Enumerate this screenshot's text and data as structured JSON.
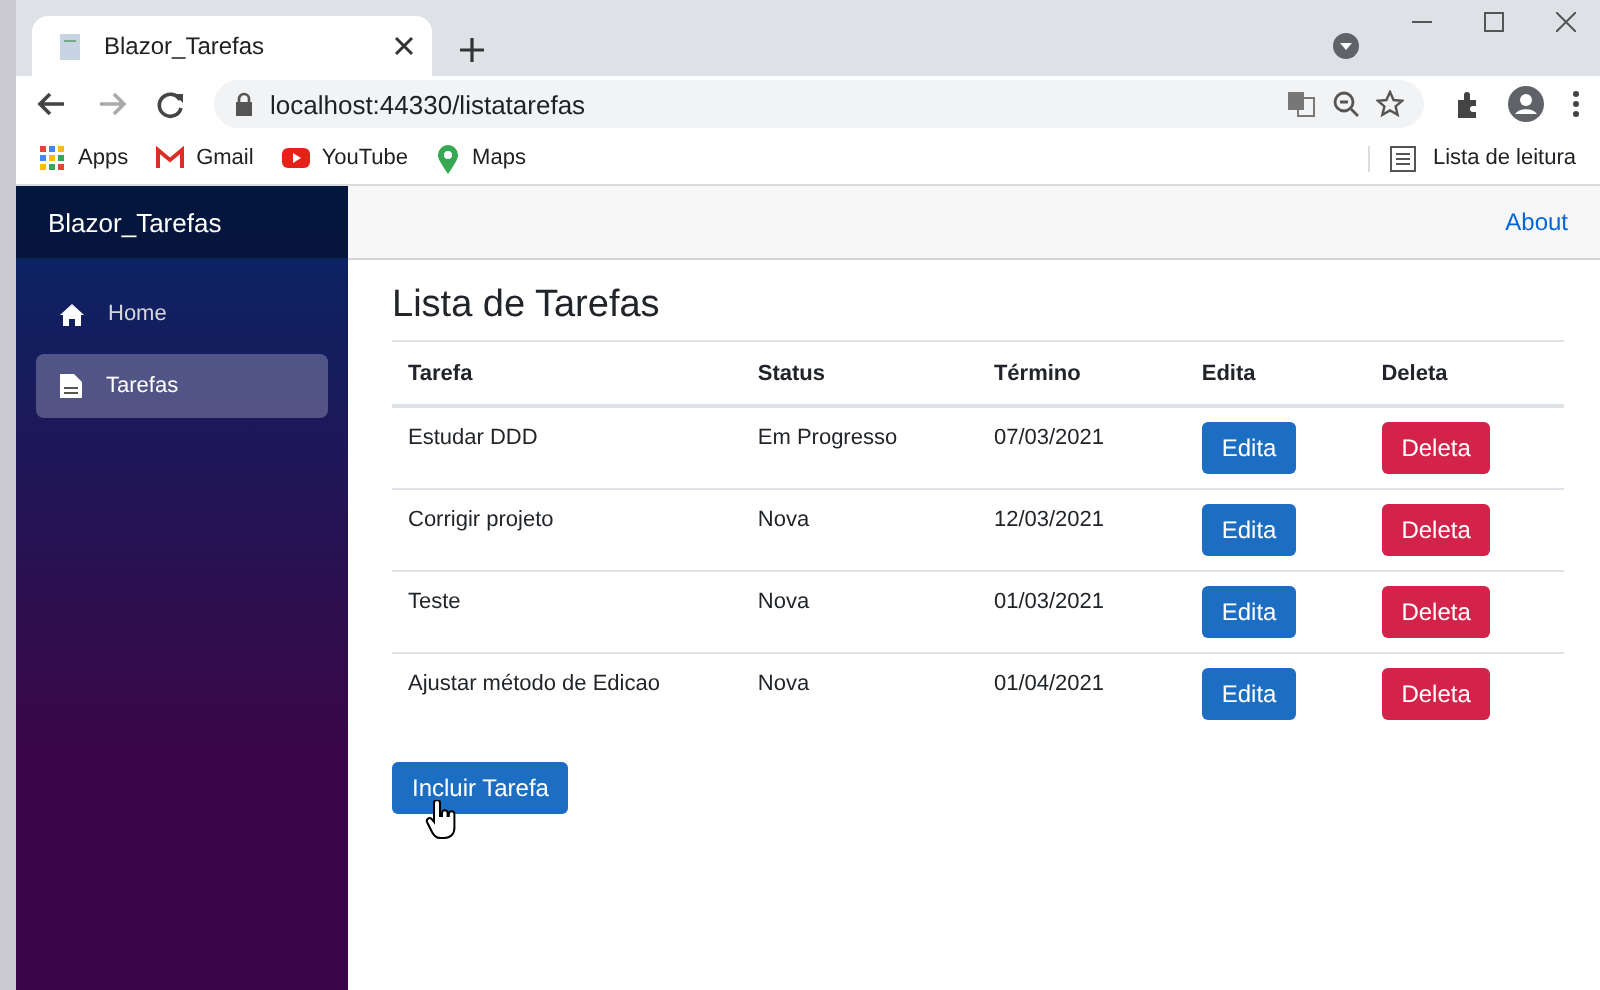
{
  "browser": {
    "tab_title": "Blazor_Tarefas",
    "url": "localhost:44330/listatarefas",
    "bookmarks": [
      {
        "label": "Apps",
        "kind": "apps"
      },
      {
        "label": "Gmail",
        "kind": "mail"
      },
      {
        "label": "YouTube",
        "kind": "video"
      },
      {
        "label": "Maps",
        "kind": "pin"
      }
    ],
    "reading_list": "Lista de leitura"
  },
  "app": {
    "brand": "Blazor_Tarefas",
    "nav": [
      {
        "label": "Home",
        "kind": "home",
        "selected": false
      },
      {
        "label": "Tarefas",
        "kind": "doc",
        "selected": true
      }
    ],
    "top_link": "About",
    "heading": "Lista de Tarefas",
    "table": {
      "columns": [
        "Tarefa",
        "Status",
        "Término",
        "Edita",
        "Deleta"
      ],
      "rows": [
        {
          "tarefa": "Estudar DDD",
          "status": "Em Progresso",
          "termino": "07/03/2021",
          "edit": "Edita",
          "delete": "Deleta"
        },
        {
          "tarefa": "Corrigir projeto",
          "status": "Nova",
          "termino": "12/03/2021",
          "edit": "Edita",
          "delete": "Deleta"
        },
        {
          "tarefa": "Teste",
          "status": "Nova",
          "termino": "01/03/2021",
          "edit": "Edita",
          "delete": "Deleta"
        },
        {
          "tarefa": "Ajustar método de Edicao",
          "status": "Nova",
          "termino": "01/04/2021",
          "edit": "Edita",
          "delete": "Deleta"
        }
      ]
    },
    "add_button": "Incluir Tarefa"
  }
}
